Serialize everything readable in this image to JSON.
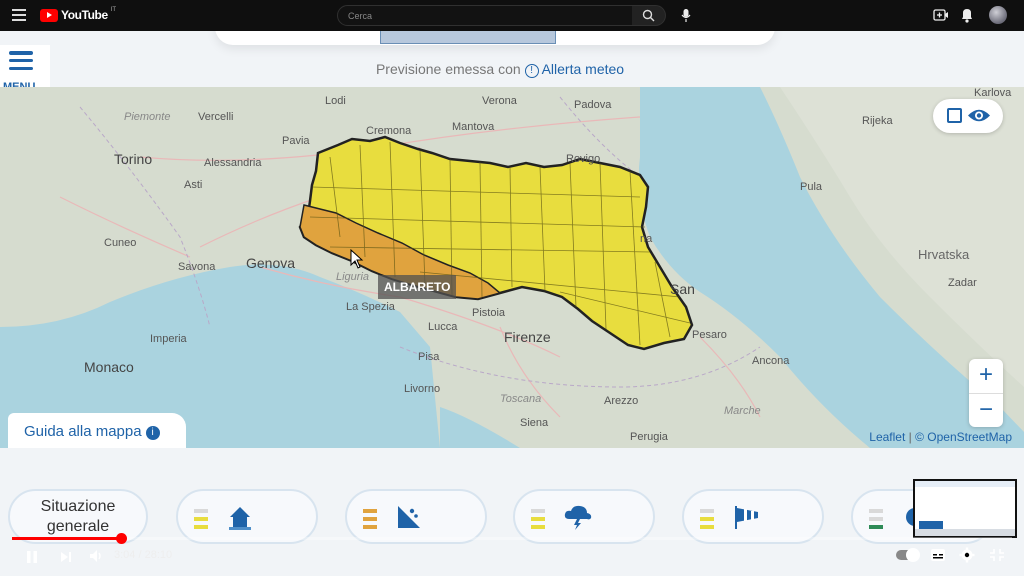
{
  "youtube": {
    "brand": "YouTube",
    "region_code": "IT",
    "search_placeholder": "Cerca",
    "icons": [
      "menu-icon",
      "search-icon",
      "mic-icon",
      "create-icon",
      "bell-icon",
      "avatar"
    ]
  },
  "app": {
    "menu_label": "MENU",
    "forecast_prefix": "Previsione emessa con",
    "forecast_link": "Allerta meteo",
    "map_guide": "Guida alla mappa",
    "tooltip": "ALBARETO",
    "attribution_leaflet": "Leaflet",
    "attribution_osm": "© OpenStreetMap",
    "zoom_in": "+",
    "zoom_out": "−",
    "situation_tile": "Situazione generale",
    "colors": {
      "alert_yellow": "#e8dd3e",
      "alert_orange": "#e0a33e",
      "brand_blue": "#1f63a8"
    },
    "tile_icons": [
      "house-icon",
      "landslide-icon",
      "storm-cloud-icon",
      "windsock-icon",
      "snow-icon"
    ]
  },
  "map_labels": {
    "cities": [
      {
        "name": "Lodi"
      },
      {
        "name": "Verona"
      },
      {
        "name": "Padova"
      },
      {
        "name": "Vercelli"
      },
      {
        "name": "Piemonte"
      },
      {
        "name": "Mantova"
      },
      {
        "name": "Cremona"
      },
      {
        "name": "Pavia"
      },
      {
        "name": "Torino"
      },
      {
        "name": "Alessandria"
      },
      {
        "name": "Rovigo"
      },
      {
        "name": "Asti"
      },
      {
        "name": "Cuneo"
      },
      {
        "name": "Savona"
      },
      {
        "name": "Genova"
      },
      {
        "name": "Liguria"
      },
      {
        "name": "La Spezia"
      },
      {
        "name": "Lucca"
      },
      {
        "name": "Pistoia"
      },
      {
        "name": "Firenze"
      },
      {
        "name": "Imperia"
      },
      {
        "name": "Monaco"
      },
      {
        "name": "Pisa"
      },
      {
        "name": "Livorno"
      },
      {
        "name": "Toscana"
      },
      {
        "name": "Arezzo"
      },
      {
        "name": "Siena"
      },
      {
        "name": "Perugia"
      },
      {
        "name": "Pesaro"
      },
      {
        "name": "Ancona"
      },
      {
        "name": "Marche"
      },
      {
        "name": "San"
      },
      {
        "name": "Rijeka"
      },
      {
        "name": "Pula"
      },
      {
        "name": "Hrvatska"
      },
      {
        "name": "Zadar"
      },
      {
        "name": "Karlova"
      },
      {
        "name": "na"
      }
    ]
  },
  "player": {
    "time": "3:04 / 28:10",
    "progress_fraction": 0.109,
    "controls": [
      "play-pause-icon",
      "next-icon",
      "volume-icon",
      "autoplay-toggle",
      "captions-icon",
      "settings-icon",
      "miniplayer-icon"
    ]
  }
}
